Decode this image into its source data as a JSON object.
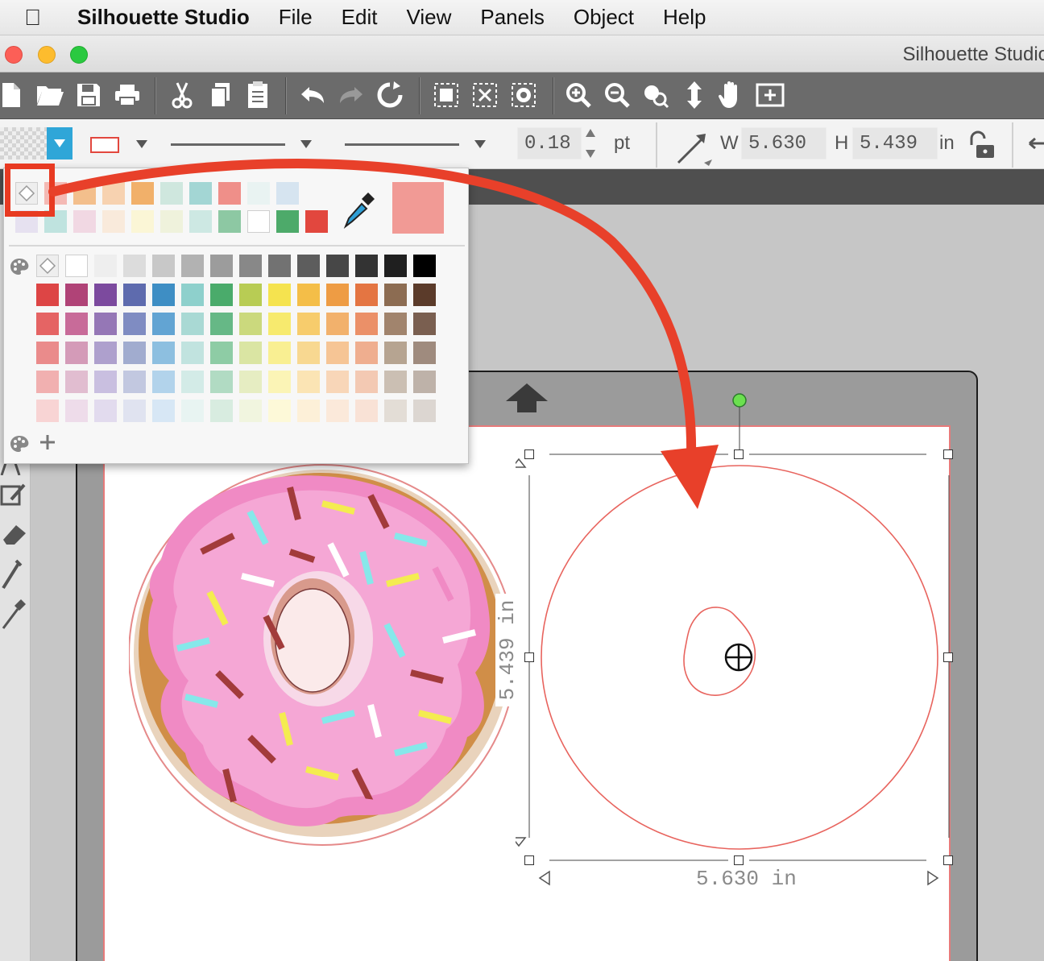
{
  "menubar": {
    "app_name": "Silhouette Studio",
    "items": [
      "File",
      "Edit",
      "View",
      "Panels",
      "Object",
      "Help"
    ]
  },
  "window": {
    "title": "Silhouette Studio"
  },
  "toolbar": {
    "icons": [
      "new-document-icon",
      "open-folder-icon",
      "save-icon",
      "print-icon",
      "cut-icon",
      "copy-icon",
      "paste-icon",
      "undo-icon",
      "redo-icon",
      "redraw-icon",
      "group-icon",
      "ungroup-icon",
      "release-compound-icon",
      "zoom-in-icon",
      "zoom-out-icon",
      "zoom-select-icon",
      "pan-move-icon",
      "hand-icon",
      "fit-page-icon"
    ]
  },
  "propbar": {
    "line_weight": "0.18",
    "line_weight_unit": "pt",
    "width_label": "W",
    "width_value": "5.630",
    "height_label": "H",
    "height_value": "5.439",
    "size_unit": "in"
  },
  "palette": {
    "recent_row1": [
      "transparent",
      "#f4b9b4",
      "#f3bf8c",
      "#f7d2b0",
      "#f1b06a",
      "#cfe7de",
      "#a3d6d4",
      "#ef8f89",
      "#e9f3f2",
      "#d6e4f0"
    ],
    "recent_row2": [
      "#e6e1f0",
      "#bfe3df",
      "#f1d8e3",
      "#f9eadb",
      "#fbf6d6",
      "#eff2dc",
      "#cde8e3",
      "#8dc8a3",
      "#ffffff",
      "#4daa6a",
      "#e2473e"
    ],
    "current_preview": "#f19a95",
    "grid": [
      [
        "transparent",
        "#ffffff",
        "#eeeeee",
        "#dcdcdc",
        "#c8c8c8",
        "#b2b2b2",
        "#9c9c9c",
        "#888888",
        "#727272",
        "#5d5d5d",
        "#474747",
        "#333333",
        "#1f1f1f",
        "#000000"
      ],
      [
        "#dd4545",
        "#b04377",
        "#7c4a9e",
        "#5e6bae",
        "#3e8ec4",
        "#8ed0cc",
        "#4aab6b",
        "#b8cc54",
        "#f5e34f",
        "#f4be48",
        "#ee9c44",
        "#e47542",
        "#8c6c52",
        "#5b3b2a"
      ],
      [
        "#e56464",
        "#c86b99",
        "#9577b6",
        "#7f8cc2",
        "#62a4d3",
        "#a9d9d4",
        "#66b886",
        "#cbd97d",
        "#f7ea6e",
        "#f7cc6c",
        "#f2b16c",
        "#eb9068",
        "#a1846d",
        "#7a5f50"
      ],
      [
        "#ea8b8b",
        "#d49bb8",
        "#aea0cd",
        "#a1accf",
        "#8dbfe0",
        "#c1e3df",
        "#8ecca5",
        "#dae5a3",
        "#f9ef92",
        "#f8d891",
        "#f6c595",
        "#efae8f",
        "#b6a491",
        "#9f8b7e"
      ],
      [
        "#f1b0b0",
        "#e1bdd0",
        "#c9bfe0",
        "#c2c8e0",
        "#b2d3eb",
        "#d3ebe7",
        "#b1dbc3",
        "#e6edc2",
        "#fbf4b6",
        "#fbe4b4",
        "#f8d6b8",
        "#f3c9b3",
        "#cbbfb3",
        "#beb2a9"
      ],
      [
        "#f8d4d4",
        "#eedcea",
        "#e2dbee",
        "#e0e3f0",
        "#d7e7f5",
        "#e8f4f2",
        "#d8ece0",
        "#f1f5df",
        "#fdf9d8",
        "#fdf0d8",
        "#fbe9da",
        "#f9e2d6",
        "#e3ddd6",
        "#dcd6d1"
      ]
    ]
  },
  "selection": {
    "width_label": "5.630 in",
    "height_label": "5.439 in"
  }
}
